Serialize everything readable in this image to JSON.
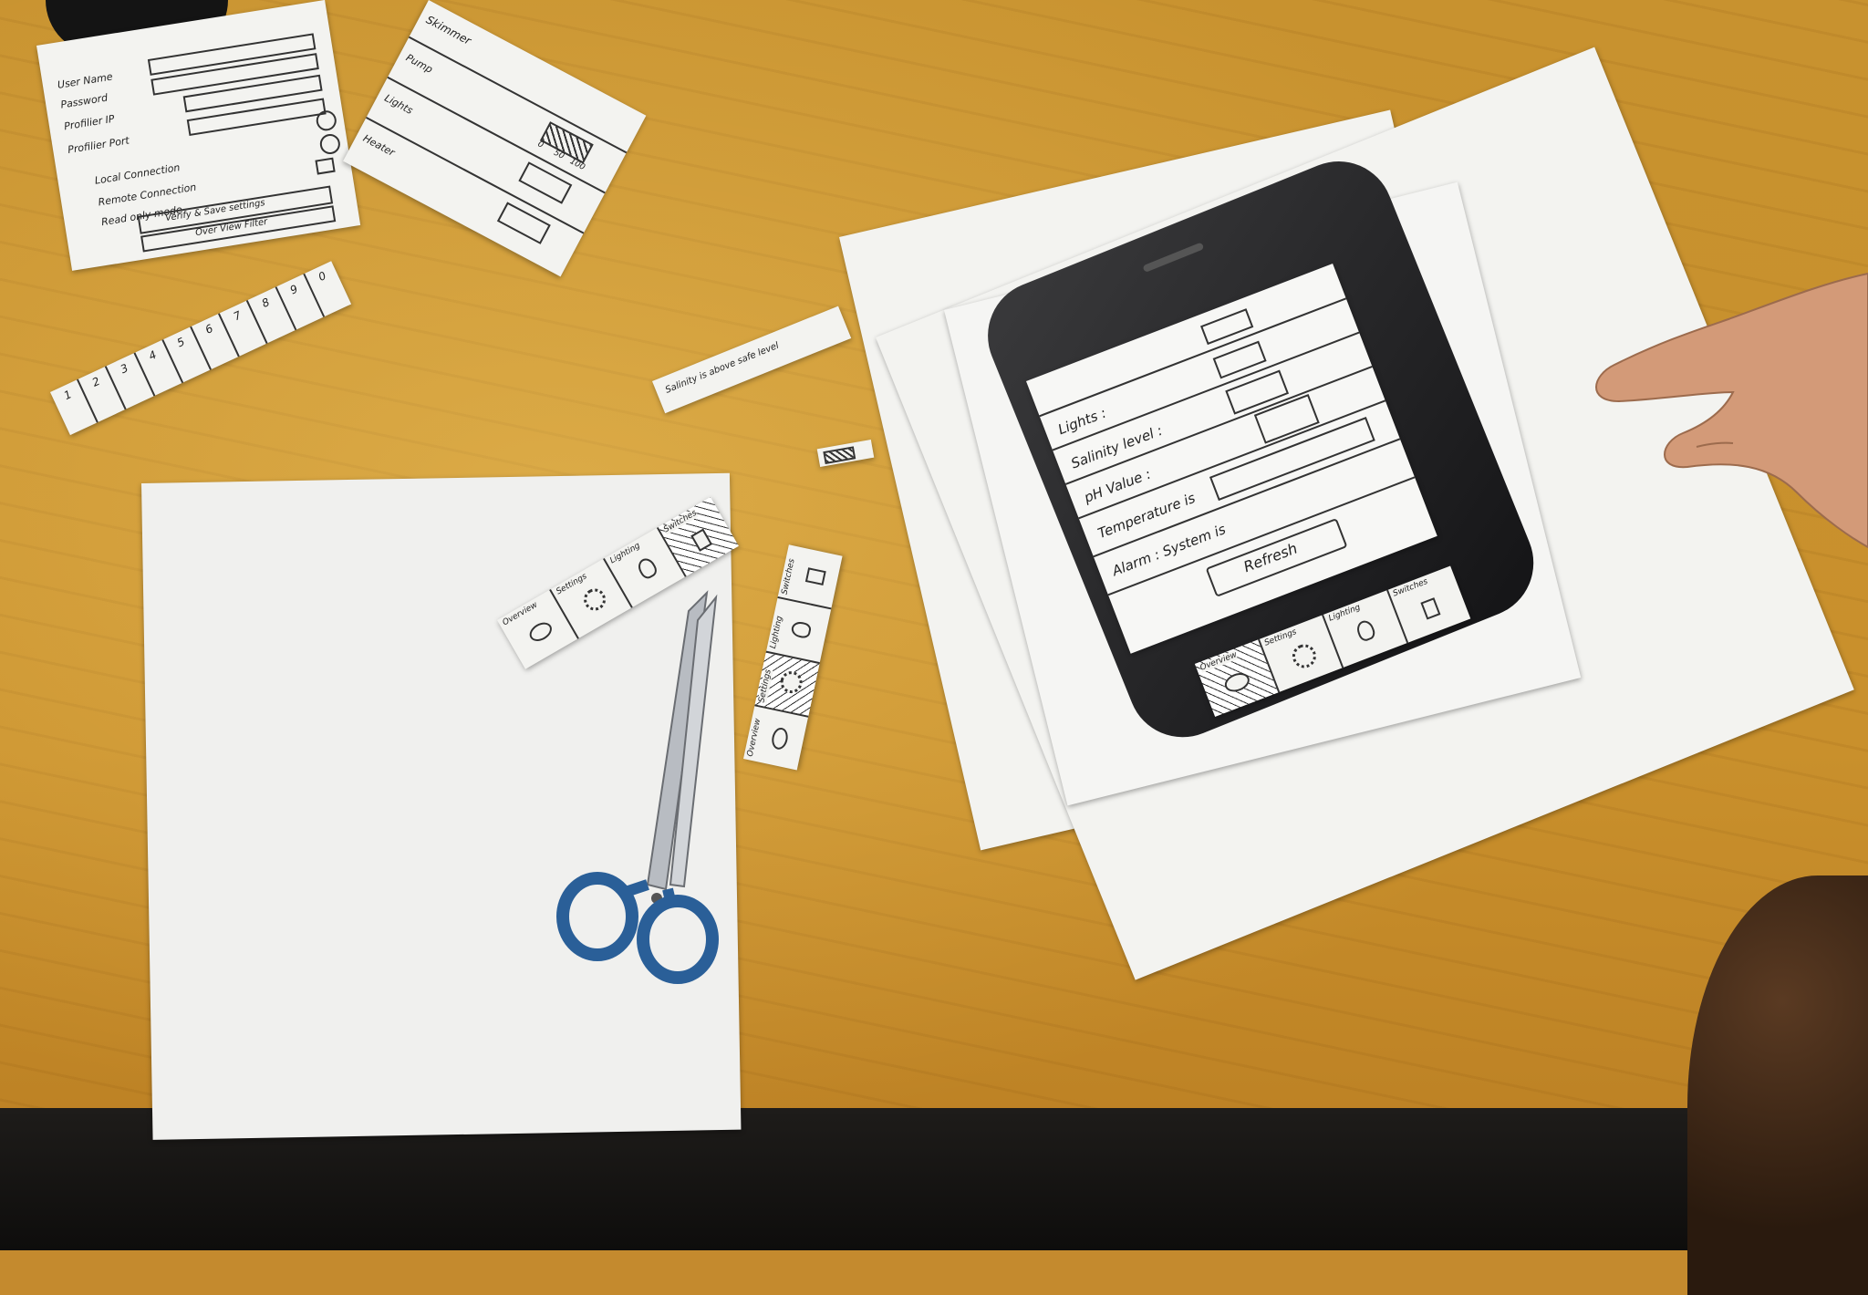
{
  "login_sketch": {
    "rows": [
      "User Name",
      "Password",
      "Profilier IP",
      "Profilier Port",
      "Local Connection",
      "Remote Connection",
      "Read only mode"
    ],
    "verify_button": "Verify & Save settings",
    "overview_button": "Over View Filter"
  },
  "pump_sketch": {
    "title": "Skimmer",
    "rows": [
      "Pump",
      "Lights",
      "Heater"
    ],
    "slider_ticks": [
      "0",
      "50",
      "100"
    ]
  },
  "keypad_strip": {
    "cells": [
      "1",
      "2",
      "3",
      "4",
      "5",
      "6",
      "7",
      "8",
      "9",
      "0"
    ]
  },
  "salinity_note": {
    "text": "Salinity is above safe level"
  },
  "tabbar_a": {
    "tabs": [
      "Overview",
      "Settings",
      "Lighting",
      "Switches"
    ]
  },
  "tabbar_b": {
    "tabs": [
      "Overview",
      "Settings",
      "Lighting",
      "Switches"
    ]
  },
  "phone_screen": {
    "rows": [
      "Lights :",
      "Salinity level :",
      "pH Value :",
      "Temperature is",
      "Alarm : System is"
    ],
    "refresh_button": "Refresh",
    "tabs": [
      "Overview",
      "Settings",
      "Lighting",
      "Switches"
    ]
  }
}
